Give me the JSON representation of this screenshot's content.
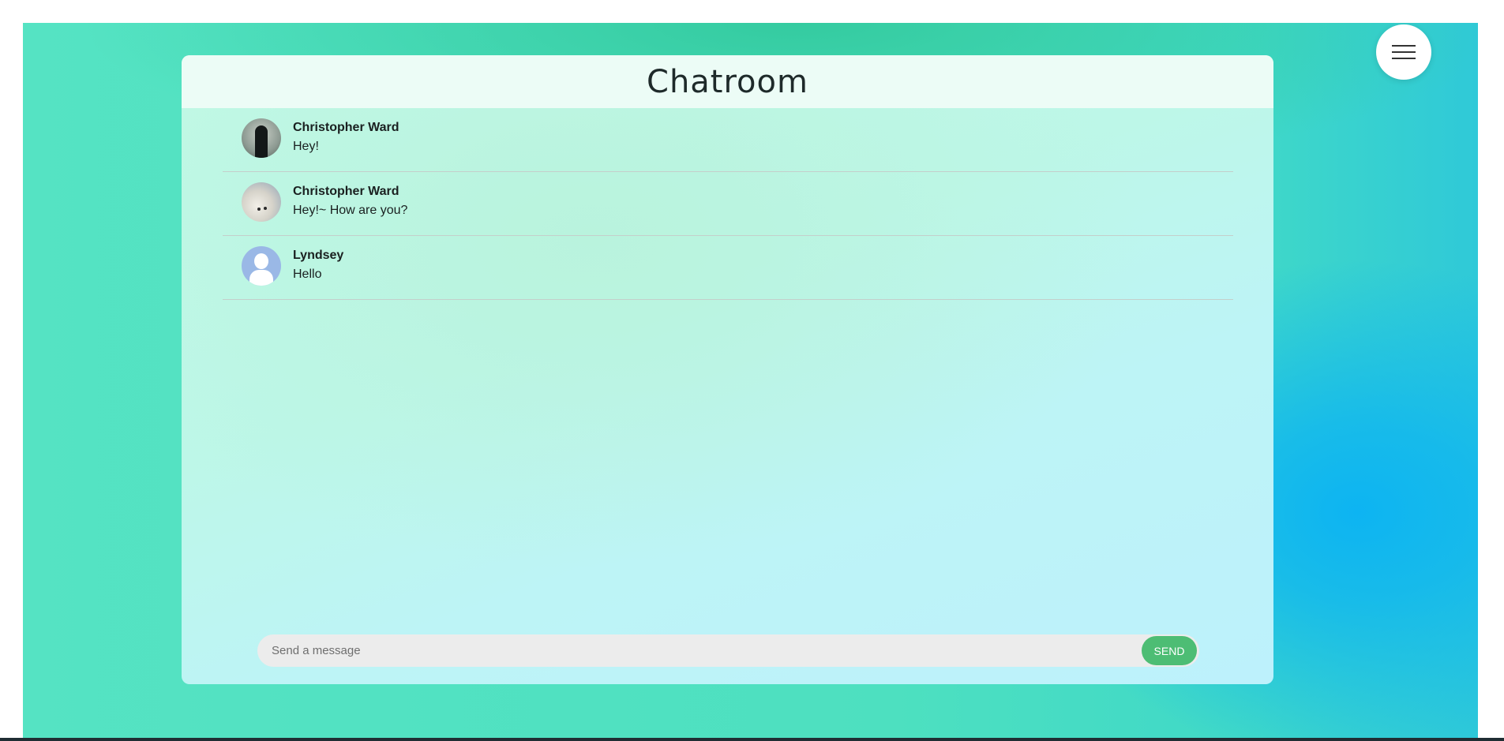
{
  "chatroom": {
    "title": "Chatroom"
  },
  "menu": {
    "icon": "hamburger-menu-icon"
  },
  "messages": [
    {
      "author": "Christopher Ward",
      "text": "Hey!",
      "avatar": "photo"
    },
    {
      "author": "Christopher Ward",
      "text": "Hey!~ How are you?",
      "avatar": "photo"
    },
    {
      "author": "Lyndsey",
      "text": "Hello",
      "avatar": "default-user-icon"
    }
  ],
  "composer": {
    "placeholder": "Send a message",
    "value": "",
    "send_label": "SEND"
  },
  "colors": {
    "background_teal": "#55e3c3",
    "background_blue": "#0db4f2",
    "send_button": "#4dbd74",
    "default_avatar": "#9ab8e6"
  }
}
